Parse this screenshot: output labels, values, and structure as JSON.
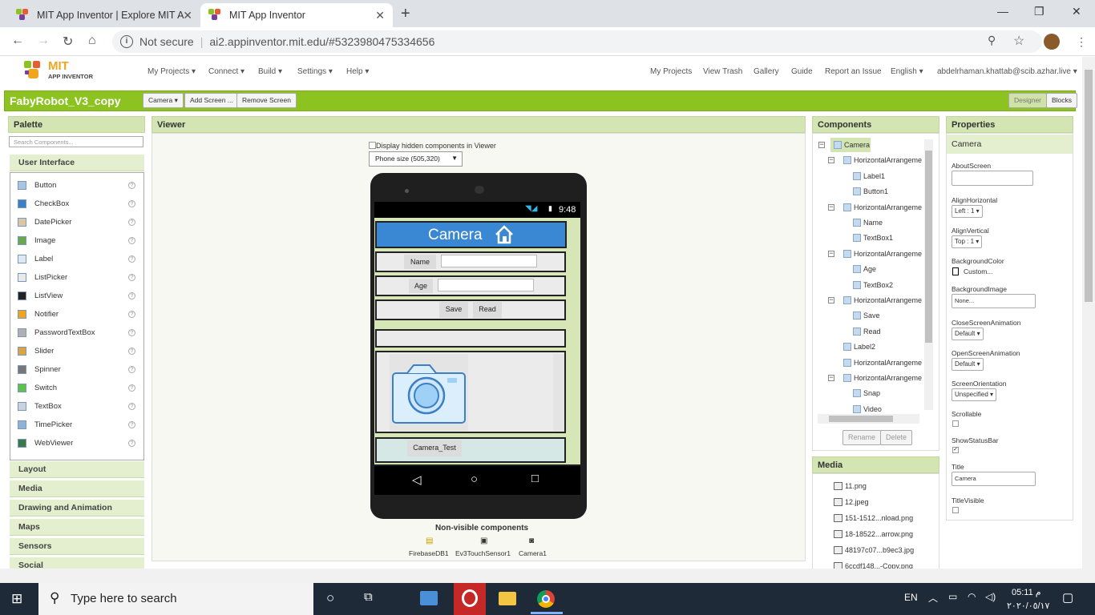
{
  "browser": {
    "tabs": [
      {
        "title": "MIT App Inventor | Explore MIT A",
        "active": false
      },
      {
        "title": "MIT App Inventor",
        "active": true
      }
    ],
    "new_tab_symbol": "+",
    "window_controls": {
      "minimize": "—",
      "maximize": "❐",
      "close": "✕"
    },
    "address": {
      "security_label": "Not secure",
      "url": "ai2.appinventor.mit.edu/#5323980475334656"
    },
    "nav_icons": [
      "back-arrow-icon",
      "forward-arrow-icon",
      "reload-icon",
      "home-icon"
    ]
  },
  "app": {
    "logo": {
      "mit": "MIT",
      "app_inventor": "APP INVENTOR"
    },
    "left_menu": [
      "My Projects ▾",
      "Connect ▾",
      "Build ▾",
      "Settings ▾",
      "Help ▾"
    ],
    "right_menu": [
      "My Projects",
      "View Trash",
      "Gallery",
      "Guide",
      "Report an Issue",
      "English ▾",
      "abdelrhaman.khattab@scib.azhar.live ▾"
    ],
    "project": {
      "name": "FabyRobot_V3_copy",
      "screen_select": "Camera ▾",
      "add_screen": "Add Screen ...",
      "remove_screen": "Remove Screen",
      "designer": "Designer",
      "blocks": "Blocks"
    },
    "colors": {
      "accent_green": "#8dc321",
      "panel_header": "#d3e5b3",
      "title_bar_blue": "#3a87d4"
    }
  },
  "palette": {
    "title": "Palette",
    "search_placeholder": "Search Components...",
    "open_category": "User Interface",
    "items": [
      "Button",
      "CheckBox",
      "DatePicker",
      "Image",
      "Label",
      "ListPicker",
      "ListView",
      "Notifier",
      "PasswordTextBox",
      "Slider",
      "Spinner",
      "Switch",
      "TextBox",
      "TimePicker",
      "WebViewer"
    ],
    "help_symbol": "?",
    "categories": [
      "Layout",
      "Media",
      "Drawing and Animation",
      "Maps",
      "Sensors",
      "Social"
    ]
  },
  "viewer": {
    "title": "Viewer",
    "hidden_checkbox_label": "Display hidden components in Viewer",
    "phone_size": "Phone size (505,320)",
    "status_time": "9:48",
    "screen": {
      "title": "Camera",
      "name_label": "Name",
      "age_label": "Age",
      "save_button": "Save",
      "read_button": "Read",
      "camera_test_button": "Camera_Test"
    },
    "nav_buttons": [
      "back-triangle-icon",
      "home-circle-icon",
      "recents-square-icon"
    ],
    "nonvisible_title": "Non-visible components",
    "nonvisible": [
      "FirebaseDB1",
      "Ev3TouchSensor1",
      "Camera1"
    ]
  },
  "components": {
    "title": "Components",
    "tree": [
      {
        "label": "Camera",
        "level": 0,
        "collapsible": true
      },
      {
        "label": "HorizontalArrangeme",
        "level": 1,
        "collapsible": true
      },
      {
        "label": "Label1",
        "level": 2,
        "collapsible": false
      },
      {
        "label": "Button1",
        "level": 2,
        "collapsible": false
      },
      {
        "label": "HorizontalArrangeme",
        "level": 1,
        "collapsible": true
      },
      {
        "label": "Name",
        "level": 2,
        "collapsible": false
      },
      {
        "label": "TextBox1",
        "level": 2,
        "collapsible": false
      },
      {
        "label": "HorizontalArrangeme",
        "level": 1,
        "collapsible": true
      },
      {
        "label": "Age",
        "level": 2,
        "collapsible": false
      },
      {
        "label": "TextBox2",
        "level": 2,
        "collapsible": false
      },
      {
        "label": "HorizontalArrangeme",
        "level": 1,
        "collapsible": true
      },
      {
        "label": "Save",
        "level": 2,
        "collapsible": false
      },
      {
        "label": "Read",
        "level": 2,
        "collapsible": false
      },
      {
        "label": "Label2",
        "level": 1,
        "collapsible": false
      },
      {
        "label": "HorizontalArrangeme",
        "level": 1,
        "collapsible": false
      },
      {
        "label": "HorizontalArrangeme",
        "level": 1,
        "collapsible": true
      },
      {
        "label": "Snap",
        "level": 2,
        "collapsible": false
      },
      {
        "label": "Video",
        "level": 2,
        "collapsible": false
      }
    ],
    "rename": "Rename",
    "delete": "Delete"
  },
  "properties": {
    "title": "Properties",
    "component": "Camera",
    "fields": {
      "about_screen": {
        "label": "AboutScreen",
        "value": ""
      },
      "align_horizontal": {
        "label": "AlignHorizontal",
        "value": "Left : 1 ▾"
      },
      "align_vertical": {
        "label": "AlignVertical",
        "value": "Top : 1 ▾"
      },
      "background_color": {
        "label": "BackgroundColor",
        "value": "Custom..."
      },
      "background_image": {
        "label": "BackgroundImage",
        "value": "None..."
      },
      "close_screen_animation": {
        "label": "CloseScreenAnimation",
        "value": "Default ▾"
      },
      "open_screen_animation": {
        "label": "OpenScreenAnimation",
        "value": "Default ▾"
      },
      "screen_orientation": {
        "label": "ScreenOrientation",
        "value": "Unspecified ▾"
      },
      "scrollable": {
        "label": "Scrollable",
        "checked": false
      },
      "show_status_bar": {
        "label": "ShowStatusBar",
        "checked": true
      },
      "title": {
        "label": "Title",
        "value": "Camera"
      },
      "title_visible": {
        "label": "TitleVisible",
        "checked": false
      }
    }
  },
  "media": {
    "title": "Media",
    "files": [
      "11.png",
      "12.jpeg",
      "151-1512...nload.png",
      "18-18522...arrow.png",
      "48197c07...b9ec3.jpg",
      "6ccdf148...-Copy.png"
    ]
  },
  "taskbar": {
    "search_placeholder": "Type here to search",
    "lang": "EN",
    "time": "05:11 م",
    "date": "٢٠٢٠/٠٥/١٧"
  }
}
